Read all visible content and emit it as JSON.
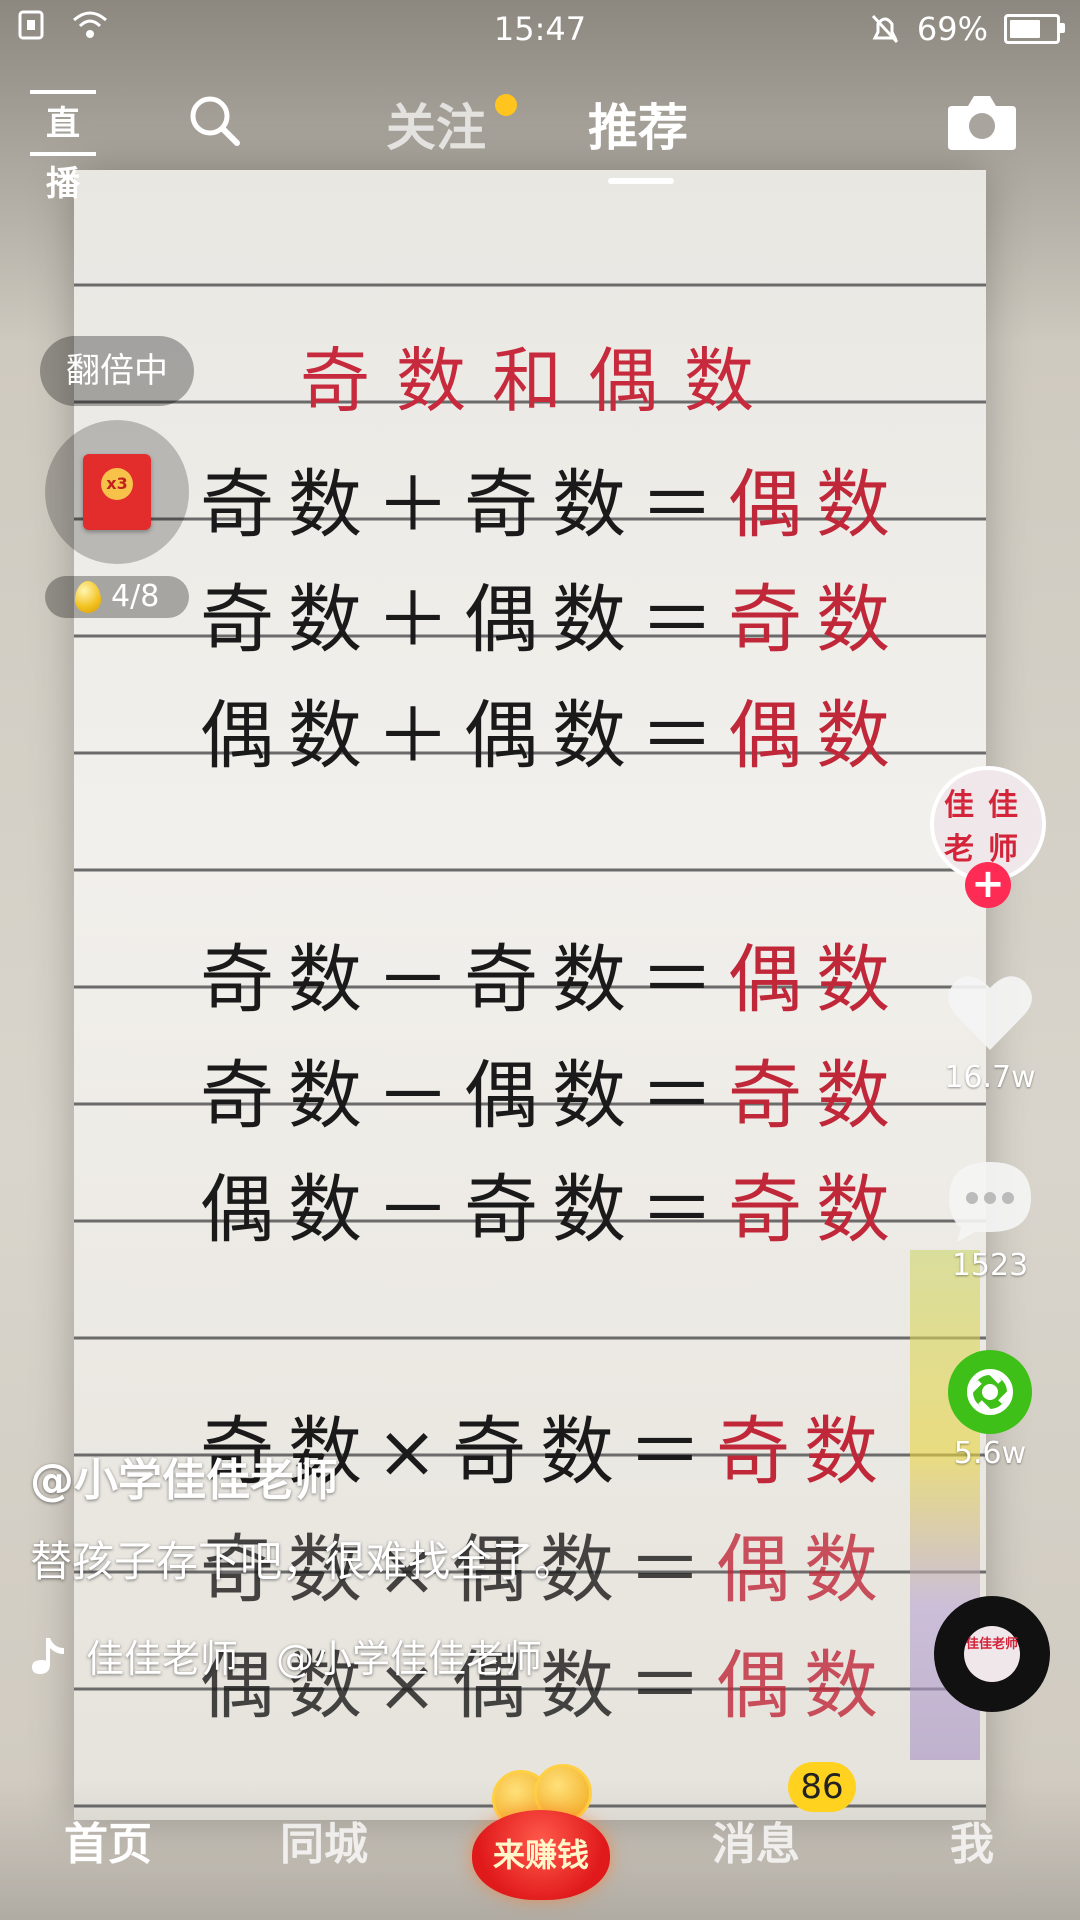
{
  "status_bar": {
    "time": "15:47",
    "battery": "69%",
    "battery_level": 0.69,
    "icons": [
      "sim-icon",
      "wifi-icon",
      "mute-bell-icon",
      "battery-icon"
    ]
  },
  "top_nav": {
    "live_label": "直播",
    "tabs": [
      {
        "label": "关注",
        "has_dot": true
      },
      {
        "label": "推荐",
        "active": true
      }
    ],
    "dot_color": "#ffc41d"
  },
  "reward_widget": {
    "double_label": "翻倍中",
    "multiplier": "x3",
    "progress": "4/8"
  },
  "video_content": {
    "title": "奇数和偶数",
    "lines": [
      {
        "left": "奇数＋奇数＝",
        "right": "偶数"
      },
      {
        "left": "奇数＋偶数＝",
        "right": "奇数"
      },
      {
        "left": "偶数＋偶数＝",
        "right": "偶数"
      },
      {
        "left": "奇数－奇数＝",
        "right": "偶数"
      },
      {
        "left": "奇数－偶数＝",
        "right": "奇数"
      },
      {
        "left": "偶数－奇数＝",
        "right": "奇数"
      },
      {
        "left": "奇数×奇数＝",
        "right": "奇数"
      },
      {
        "left": "奇数×偶数＝",
        "right": "偶数"
      },
      {
        "left": "偶数×偶数＝",
        "right": "偶数"
      }
    ]
  },
  "side_actions": {
    "avatar_text": "佳佳老师",
    "likes": "16.7w",
    "comments": "1523",
    "shares": "5.6w",
    "disc_text": "佳佳老师"
  },
  "caption": {
    "author": "@小学佳佳老师",
    "description": "替孩子存下吧，很难找全了。",
    "music": "佳佳老师　@小学佳佳老师"
  },
  "bottom_nav": {
    "home": "首页",
    "city": "同城",
    "earn": "来赚钱",
    "messages": "消息",
    "messages_badge": "86",
    "me": "我"
  },
  "colors": {
    "accent_red": "#fe2c55",
    "share_green": "#3fc018",
    "badge_yellow": "#ffd21f"
  }
}
